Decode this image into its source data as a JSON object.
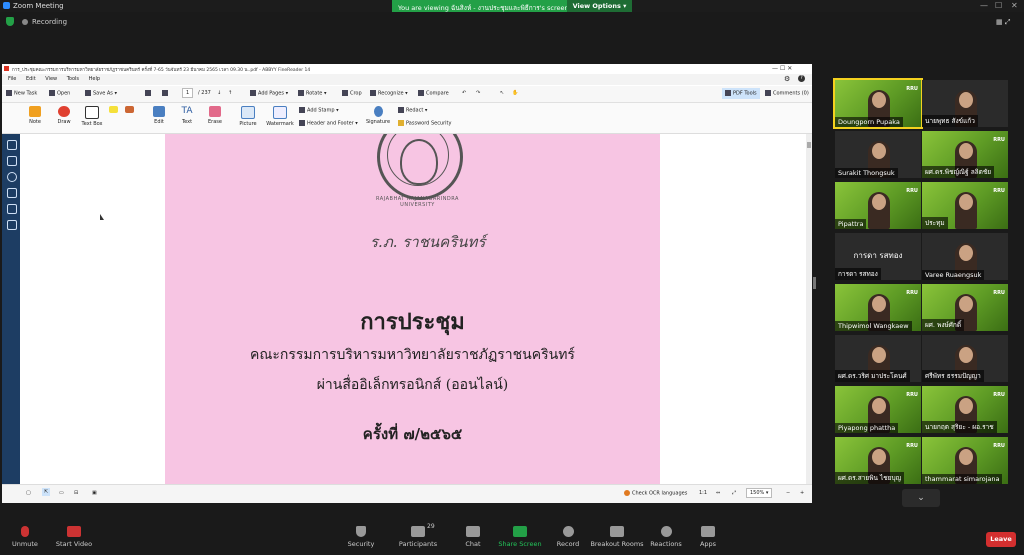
{
  "zoom": {
    "window_title": "Zoom Meeting",
    "share_banner": "You are viewing ฉันสิงห์ - งานประชุมและพิธีการ's screen",
    "view_options": "View Options",
    "recording": "Recording"
  },
  "abbyy": {
    "title": "การ_ประชุมคณะกรรมการบริหารมหาวิทยาลัยราชภัฏราชนครินทร์ ครั้งที่ 7-65 วันจันทร์ 23 มีนาคม 2565 เวลา 09.30 น..pdf - ABBYY FineReader 14",
    "menu": [
      "File",
      "Edit",
      "View",
      "Tools",
      "Help"
    ],
    "toolbar1": {
      "new_task": "New Task",
      "open": "Open",
      "save_as": "Save As",
      "page_current": "1",
      "page_total": "/ 237",
      "add_pages": "Add Pages",
      "rotate": "Rotate",
      "crop": "Crop",
      "recognize": "Recognize",
      "compare": "Compare",
      "pdf_tools": "PDF Tools",
      "comments": "Comments (0)"
    },
    "toolbar2": {
      "note": "Note",
      "draw": "Draw",
      "text_box": "Text Box",
      "edit": "Edit",
      "text": "Text",
      "erase": "Erase",
      "picture": "Picture",
      "watermark": "Watermark",
      "add_stamp": "Add Stamp",
      "header_footer": "Header and Footer",
      "signature": "Signature",
      "redact": "Redact",
      "password_security": "Password Security"
    },
    "status": {
      "check_ocr": "Check OCR languages",
      "ratio": "1:1",
      "zoom": "150%"
    }
  },
  "document": {
    "seal_text": "RAJABHAT RAJANAGARINDRA UNIVERSITY",
    "handwriting": "ร.ภ. ราชนครินทร์",
    "heading": "การประชุม",
    "line1": "คณะกรรมการบริหารมหาวิทยาลัยราชภัฏราชนครินทร์",
    "line2": "ผ่านสื่ออิเล็กทรอนิกส์ (ออนไลน์)",
    "line3": "ครั้งที่ ๗/๒๕๖๕"
  },
  "participants": [
    {
      "name": "Doungporn Pupaka",
      "style": "green",
      "highlight": true
    },
    {
      "name": "นายพุทธ สังข์แก้ว",
      "style": "dark"
    },
    {
      "name": "Surakit Thongsuk",
      "style": "dark"
    },
    {
      "name": "ผศ.ดร.พิชญ์ณิฐ์ ลลิตชัย",
      "style": "green"
    },
    {
      "name": "Pipattra",
      "style": "green"
    },
    {
      "name": "ประทุม",
      "style": "green"
    },
    {
      "name": "การดา รสทอง",
      "style": "dark",
      "big": "การดา รสทอง"
    },
    {
      "name": "Varee Ruaengsuk",
      "style": "dark"
    },
    {
      "name": "Thipwimol Wangkaew",
      "style": "green"
    },
    {
      "name": "ผศ. พงษ์ศักดิ์",
      "style": "green"
    },
    {
      "name": "ผศ.ดร.วริศ มาประโคนศ์",
      "style": "dark"
    },
    {
      "name": "ศรีพัทร ธรรมปัญญา",
      "style": "dark"
    },
    {
      "name": "Piyapong phattha",
      "style": "green"
    },
    {
      "name": "นายกฤต สุริยะ - ผอ.ราช",
      "style": "green"
    },
    {
      "name": "ผศ.ดร.สายพิน ไชยบุญ",
      "style": "green"
    },
    {
      "name": "thammarat simarojana",
      "style": "green"
    }
  ],
  "logo_text": "RRU",
  "controls": {
    "unmute": "Unmute",
    "start_video": "Start Video",
    "security": "Security",
    "participants": "Participants",
    "participants_count": "29",
    "chat": "Chat",
    "share_screen": "Share Screen",
    "record": "Record",
    "breakout_rooms": "Breakout Rooms",
    "reactions": "Reactions",
    "apps": "Apps",
    "leave": "Leave"
  },
  "colors": {
    "zoom_green": "#23a047",
    "leave_red": "#d32f2f",
    "page_pink": "#f7c5e3",
    "rail_blue": "#1d3d63"
  }
}
